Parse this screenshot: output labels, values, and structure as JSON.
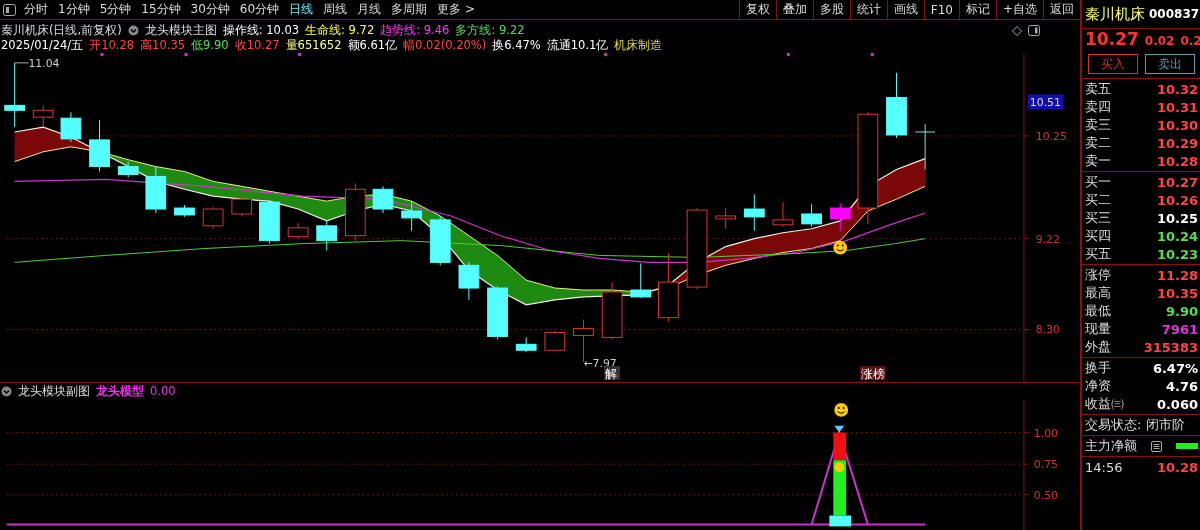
{
  "toolbar": {
    "periods": [
      {
        "label": "分时",
        "selected": false
      },
      {
        "label": "1分钟",
        "selected": false
      },
      {
        "label": "5分钟",
        "selected": false
      },
      {
        "label": "15分钟",
        "selected": false
      },
      {
        "label": "30分钟",
        "selected": false
      },
      {
        "label": "60分钟",
        "selected": false
      },
      {
        "label": "日线",
        "selected": true
      },
      {
        "label": "周线",
        "selected": false
      },
      {
        "label": "月线",
        "selected": false
      },
      {
        "label": "多周期",
        "selected": false
      },
      {
        "label": "更多 >",
        "selected": false
      }
    ],
    "buttons": [
      "复权",
      "叠加",
      "多股",
      "统计",
      "画线",
      "F10",
      "标记",
      "+自选",
      "返回"
    ]
  },
  "info": {
    "title": "秦川机床(日线,前复权)",
    "indicator": "龙头模块主图",
    "lines": [
      {
        "text": "操作线: 10.03",
        "color": "#ffffff"
      },
      {
        "text": "生命线: 9.72",
        "color": "#ffff54"
      },
      {
        "text": "趋势线: 9.46",
        "color": "#ff33ff"
      },
      {
        "text": "多方线: 9.22",
        "color": "#55dd55"
      }
    ],
    "quote": [
      {
        "text": "2025/01/24/五",
        "color": "#ffffff"
      },
      {
        "text": "开10.28",
        "color": "#ff4444"
      },
      {
        "text": "高10.35",
        "color": "#ff4444"
      },
      {
        "text": "低9.90",
        "color": "#55dd55"
      },
      {
        "text": "收10.27",
        "color": "#ff4444"
      },
      {
        "text": "量651652",
        "color": "#ffff88"
      },
      {
        "text": "额6.61亿",
        "color": "#ffffff"
      },
      {
        "text": "幅0.02(0.20%)",
        "color": "#ff4444"
      },
      {
        "text": "换6.47%",
        "color": "#ffffff"
      },
      {
        "text": "流通10.1亿",
        "color": "#ffffff"
      },
      {
        "text": "机床制造",
        "color": "#dddd33"
      }
    ]
  },
  "main_chart": {
    "axis_labels": [
      "10.51",
      "10.25",
      "9.22",
      "8.30"
    ],
    "high_label": "11.04",
    "low_label": "←7.97",
    "markers": [
      "解",
      "涨榜"
    ]
  },
  "sub_chart": {
    "title": "龙头模块副图",
    "indicator": "龙头模型",
    "value": "0.00",
    "axis_labels": [
      "1.00",
      "0.75",
      "0.50"
    ]
  },
  "quote_panel": {
    "name": "秦川机床",
    "code": "000837",
    "price": "10.27",
    "change": "0.02",
    "percent": "0.2",
    "buy": "买入",
    "sell": "卖出",
    "sells": [
      {
        "label": "卖五",
        "value": "10.32",
        "color": "#ff4444"
      },
      {
        "label": "卖四",
        "value": "10.31",
        "color": "#ff4444"
      },
      {
        "label": "卖三",
        "value": "10.30",
        "color": "#ff4444"
      },
      {
        "label": "卖二",
        "value": "10.29",
        "color": "#ff4444"
      },
      {
        "label": "卖一",
        "value": "10.28",
        "color": "#ff4444"
      }
    ],
    "buys": [
      {
        "label": "买一",
        "value": "10.27",
        "color": "#ff4444"
      },
      {
        "label": "买二",
        "value": "10.26",
        "color": "#ff4444"
      },
      {
        "label": "买三",
        "value": "10.25",
        "color": "#ffffff"
      },
      {
        "label": "买四",
        "value": "10.24",
        "color": "#55dd55"
      },
      {
        "label": "买五",
        "value": "10.23",
        "color": "#55dd55"
      }
    ],
    "stats": [
      {
        "label": "涨停",
        "value": "11.28",
        "color": "#ff4444"
      },
      {
        "label": "最高",
        "value": "10.35",
        "color": "#ff4444"
      },
      {
        "label": "最低",
        "value": "9.90",
        "color": "#55dd55"
      },
      {
        "label": "现量",
        "value": "7961",
        "color": "#dd33dd"
      },
      {
        "label": "外盘",
        "value": "315383",
        "color": "#ff4444"
      }
    ],
    "finance": [
      {
        "label": "换手",
        "value": "6.47%",
        "color": "#ffffff"
      },
      {
        "label": "净资",
        "value": "4.76",
        "color": "#ffffff"
      },
      {
        "label": "收益㈢",
        "value": "0.060",
        "color": "#ffffff"
      }
    ],
    "status": "交易状态: 闭市阶",
    "flow_label": "主力净额",
    "last_time": "14:56",
    "last_price": "10.28"
  }
}
